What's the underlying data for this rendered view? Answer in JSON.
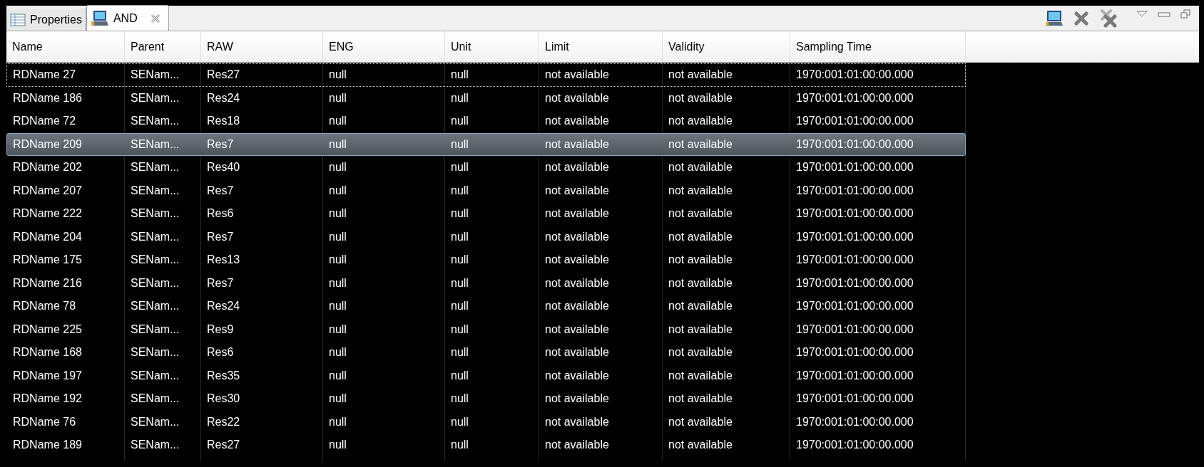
{
  "tabs": [
    {
      "label": "Properties",
      "kind": "table",
      "selected": false,
      "closable": false
    },
    {
      "label": "AND",
      "kind": "monitor",
      "selected": true,
      "closable": true
    }
  ],
  "table": {
    "columns": [
      "Name",
      "Parent",
      "RAW",
      "ENG",
      "Unit",
      "Limit",
      "Validity",
      "Sampling Time"
    ],
    "rows": [
      {
        "cells": [
          "RDName 27",
          "SENam...",
          "Res27",
          "null",
          "null",
          "not available",
          "not available",
          "1970:001:01:00:00.000"
        ],
        "selected": false,
        "focused": true
      },
      {
        "cells": [
          "RDName 186",
          "SENam...",
          "Res24",
          "null",
          "null",
          "not available",
          "not available",
          "1970:001:01:00:00.000"
        ],
        "selected": false,
        "focused": false
      },
      {
        "cells": [
          "RDName 72",
          "SENam...",
          "Res18",
          "null",
          "null",
          "not available",
          "not available",
          "1970:001:01:00:00.000"
        ],
        "selected": false,
        "focused": false
      },
      {
        "cells": [
          "RDName 209",
          "SENam...",
          "Res7",
          "null",
          "null",
          "not available",
          "not available",
          "1970:001:01:00:00.000"
        ],
        "selected": true,
        "focused": false
      },
      {
        "cells": [
          "RDName 202",
          "SENam...",
          "Res40",
          "null",
          "null",
          "not available",
          "not available",
          "1970:001:01:00:00.000"
        ],
        "selected": false,
        "focused": false
      },
      {
        "cells": [
          "RDName 207",
          "SENam...",
          "Res7",
          "null",
          "null",
          "not available",
          "not available",
          "1970:001:01:00:00.000"
        ],
        "selected": false,
        "focused": false
      },
      {
        "cells": [
          "RDName 222",
          "SENam...",
          "Res6",
          "null",
          "null",
          "not available",
          "not available",
          "1970:001:01:00:00.000"
        ],
        "selected": false,
        "focused": false
      },
      {
        "cells": [
          "RDName 204",
          "SENam...",
          "Res7",
          "null",
          "null",
          "not available",
          "not available",
          "1970:001:01:00:00.000"
        ],
        "selected": false,
        "focused": false
      },
      {
        "cells": [
          "RDName 175",
          "SENam...",
          "Res13",
          "null",
          "null",
          "not available",
          "not available",
          "1970:001:01:00:00.000"
        ],
        "selected": false,
        "focused": false
      },
      {
        "cells": [
          "RDName 216",
          "SENam...",
          "Res7",
          "null",
          "null",
          "not available",
          "not available",
          "1970:001:01:00:00.000"
        ],
        "selected": false,
        "focused": false
      },
      {
        "cells": [
          "RDName 78",
          "SENam...",
          "Res24",
          "null",
          "null",
          "not available",
          "not available",
          "1970:001:01:00:00.000"
        ],
        "selected": false,
        "focused": false
      },
      {
        "cells": [
          "RDName 225",
          "SENam...",
          "Res9",
          "null",
          "null",
          "not available",
          "not available",
          "1970:001:01:00:00.000"
        ],
        "selected": false,
        "focused": false
      },
      {
        "cells": [
          "RDName 168",
          "SENam...",
          "Res6",
          "null",
          "null",
          "not available",
          "not available",
          "1970:001:01:00:00.000"
        ],
        "selected": false,
        "focused": false
      },
      {
        "cells": [
          "RDName 197",
          "SENam...",
          "Res35",
          "null",
          "null",
          "not available",
          "not available",
          "1970:001:01:00:00.000"
        ],
        "selected": false,
        "focused": false
      },
      {
        "cells": [
          "RDName 192",
          "SENam...",
          "Res30",
          "null",
          "null",
          "not available",
          "not available",
          "1970:001:01:00:00.000"
        ],
        "selected": false,
        "focused": false
      },
      {
        "cells": [
          "RDName 76",
          "SENam...",
          "Res22",
          "null",
          "null",
          "not available",
          "not available",
          "1970:001:01:00:00.000"
        ],
        "selected": false,
        "focused": false
      },
      {
        "cells": [
          "RDName 189",
          "SENam...",
          "Res27",
          "null",
          "null",
          "not available",
          "not available",
          "1970:001:01:00:00.000"
        ],
        "selected": false,
        "focused": false
      }
    ]
  }
}
